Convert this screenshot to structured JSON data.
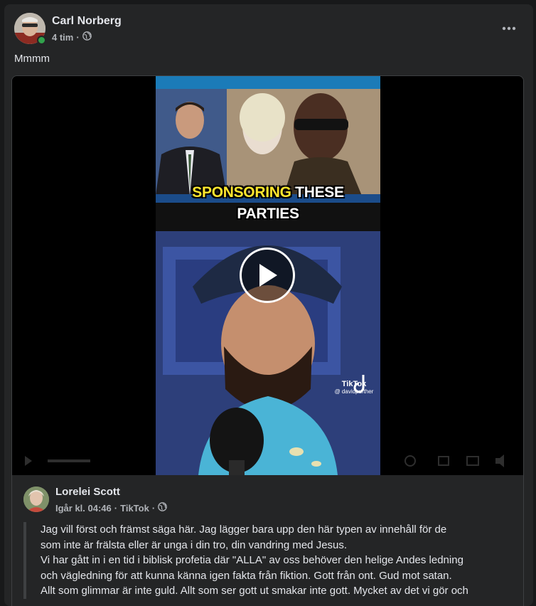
{
  "post": {
    "author": "Carl Norberg",
    "time": "4 tim",
    "separator": "·",
    "privacy_icon": "globe-icon",
    "more_icon": "more-options-icon",
    "text": "Mmmm"
  },
  "video": {
    "caption_highlight": "SPONSORING",
    "caption_rest": " THESE",
    "caption_line2": "PARTIES",
    "watermark_brand": "TikTok",
    "watermark_handle": "@ davidpurther",
    "play_icon": "play-icon"
  },
  "shared_post": {
    "author": "Lorelei Scott",
    "time": "Igår kl. 04:46",
    "separator1": "·",
    "source": "TikTok",
    "separator2": "·",
    "privacy_icon": "globe-icon",
    "body_lines": [
      "Jag vill först och främst säga här. Jag lägger bara upp den här typen av innehåll för de",
      "som inte är frälsta eller är unga i din tro, din vandring med Jesus.",
      "Vi har gått in i en tid i biblisk profetia där \"ALLA\" av oss behöver den helige Andes ledning",
      "och vägledning för att kunna känna igen fakta från fiktion. Gott från ont. Gud mot satan.",
      "Allt som glimmar är inte guld. Allt som ser gott ut smakar inte gott. Mycket av det vi gör och"
    ]
  },
  "colors": {
    "background": "#18191a",
    "card": "#242526",
    "online": "#31a24c",
    "caption_highlight": "#ffe62e"
  }
}
